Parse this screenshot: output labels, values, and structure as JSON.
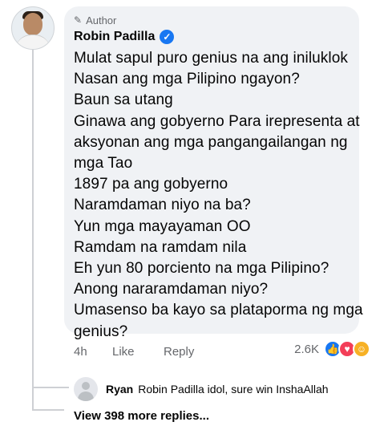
{
  "comment": {
    "badge": "Author",
    "author_name": "Robin Padilla",
    "lines": [
      "Mulat sapul puro genius na ang iniluklok",
      "Nasan ang mga Pilipino ngayon?",
      "Baun sa utang",
      "Ginawa ang gobyerno Para irepresenta at",
      "aksyonan ang mga pangangailangan ng",
      "mga Tao",
      "1897 pa ang gobyerno",
      "Naramdaman niyo na ba?",
      "Yun mga mayayaman OO",
      "Ramdam na ramdam nila",
      "Eh yun 80 porciento na mga Pilipino?",
      "Anong nararamdaman niyo?",
      "Umasenso ba kayo sa plataporma ng mga",
      "genius?"
    ],
    "time": "4h",
    "like_label": "Like",
    "reply_label": "Reply",
    "reaction_count": "2.6K",
    "reaction_icons": [
      "like-icon",
      "love-icon",
      "care-icon"
    ]
  },
  "reply": {
    "name": "Ryan",
    "text": "Robin Padilla idol, sure win InshaAllah"
  },
  "more_replies": "View 398 more replies..."
}
